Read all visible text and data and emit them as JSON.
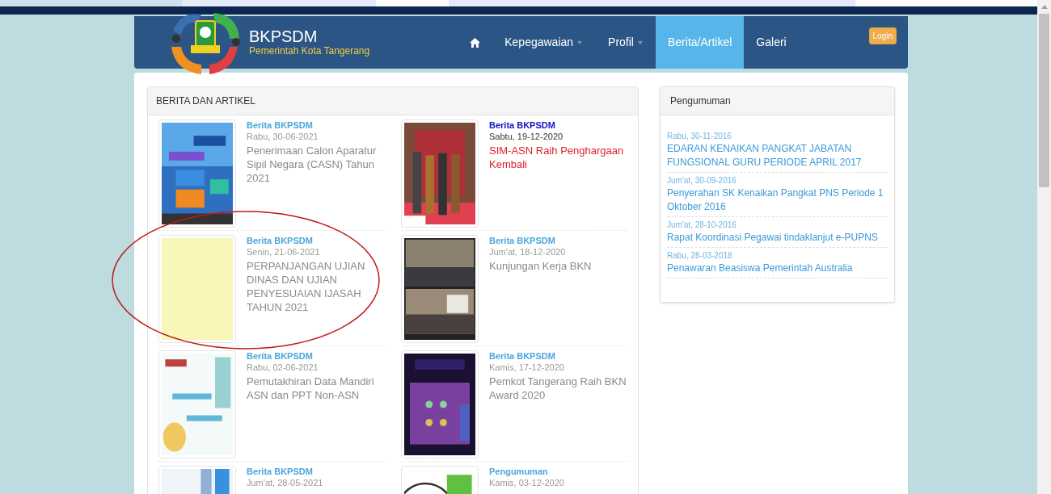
{
  "brand": {
    "title": "BKPSDM",
    "subtitle": "Pemerintah Kota Tangerang"
  },
  "nav": [
    {
      "kind": "home",
      "selected": false
    },
    {
      "kind": "dropdown",
      "label": "Kepegawaian",
      "selected": false
    },
    {
      "kind": "dropdown",
      "label": "Profil",
      "selected": false
    },
    {
      "kind": "link",
      "label": "Berita/Artikel",
      "selected": true
    },
    {
      "kind": "link",
      "label": "Galeri",
      "selected": false
    }
  ],
  "login": "Login",
  "news": {
    "title": "BERITA DAN ARTIKEL",
    "items": [
      {
        "category": "Berita BKPSDM",
        "date": "Rabu, 30-06-2021",
        "title": "Penerimaan Calon Aparatur Sipil Negara (CASN) Tahun 2021",
        "highlighted": false
      },
      {
        "category": "Berita BKPSDM",
        "date": "Sabtu, 19-12-2020",
        "title": "SIM-ASN Raih Penghargaan Kembali",
        "highlighted": true
      },
      {
        "category": "Berita BKPSDM",
        "date": "Senin, 21-06-2021",
        "title": "PERPANJANGAN UJIAN DINAS DAN UJIAN PENYESUAIAN IJASAH TAHUN 2021",
        "highlighted": false
      },
      {
        "category": "Berita BKPSDM",
        "date": "Jum'at, 18-12-2020",
        "title": "Kunjungan Kerja BKN",
        "highlighted": false
      },
      {
        "category": "Berita BKPSDM",
        "date": "Rabu, 02-06-2021",
        "title": "Pemutakhiran Data Mandiri ASN dan PPT Non-ASN",
        "highlighted": false
      },
      {
        "category": "Berita BKPSDM",
        "date": "Kamis, 17-12-2020",
        "title": "Pemkot Tangerang Raih BKN Award 2020",
        "highlighted": false
      },
      {
        "category": "Berita BKPSDM",
        "date": "Jum'at, 28-05-2021",
        "highlighted": false
      },
      {
        "category": "Pengumuman",
        "date": "Kamis, 03-12-2020",
        "highlighted": false
      }
    ]
  },
  "announcements": {
    "title": "Pengumuman",
    "items": [
      {
        "date": "Rabu, 30-11-2016",
        "title": "EDARAN KENAIKAN PANGKAT JABATAN FUNGSIONAL GURU PERIODE APRIL 2017"
      },
      {
        "date": "Jum'at, 30-09-2016",
        "title": "Penyerahan SK Kenaikan Pangkat PNS Periode 1 Oktober 2016"
      },
      {
        "date": "Jum'at, 28-10-2016",
        "title": "Rapat Koordinasi Pegawai tindaklanjut e-PUPNS"
      },
      {
        "date": "Rabu, 28-03-2018",
        "title": "Penawaran Beasiswa Pemerintah Australia"
      }
    ]
  }
}
